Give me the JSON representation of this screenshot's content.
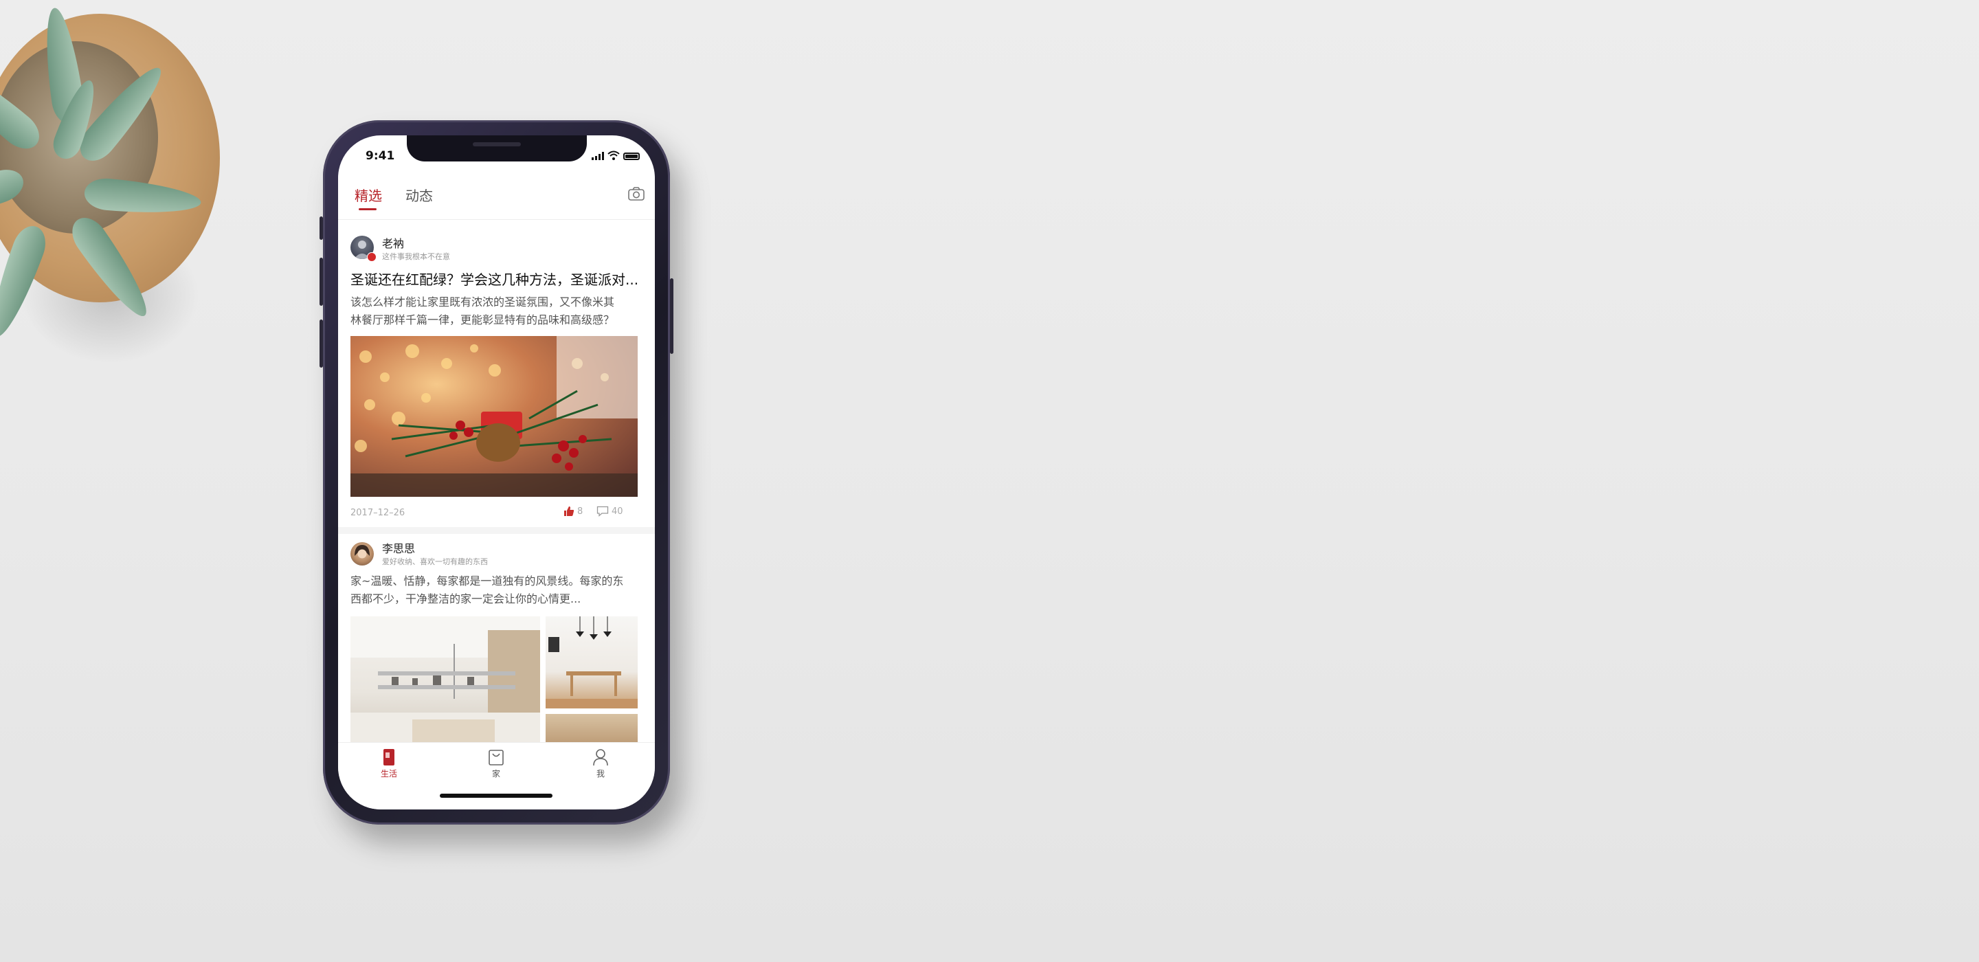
{
  "status_bar": {
    "time": "9:41"
  },
  "header": {
    "tabs": [
      {
        "label": "精选",
        "active": true
      },
      {
        "label": "动态",
        "active": false
      }
    ],
    "camera_icon": "camera-icon"
  },
  "feed": {
    "posts": [
      {
        "author": "老衲",
        "author_subtitle": "这件事我根本不在意",
        "title": "圣诞还在红配绿？学会这几种方法，圣诞派对...",
        "body_line1": "该怎么样才能让家里既有浓浓的圣诞氛围，又不像米其",
        "body_line2": "林餐厅那样千篇一律，更能彰显特有的品味和高级感？",
        "date": "2017–12–26",
        "likes": "8",
        "comments": "40"
      },
      {
        "author": "李思思",
        "author_subtitle": "爱好收纳、喜欢一切有趣的东西",
        "body_line1": "家~温暖、恬静，每家都是一道独有的风景线。每家的东",
        "body_line2": "西都不少，干净整洁的家一定会让你的心情更..."
      }
    ]
  },
  "tabbar": {
    "items": [
      {
        "label": "生活",
        "icon": "life-icon",
        "active": true
      },
      {
        "label": "家",
        "icon": "home-bag-icon",
        "active": false
      },
      {
        "label": "我",
        "icon": "user-icon",
        "active": false
      }
    ]
  },
  "colors": {
    "accent": "#b7242a",
    "background": "#ebebeb",
    "phone_frame": "#2a2738"
  }
}
